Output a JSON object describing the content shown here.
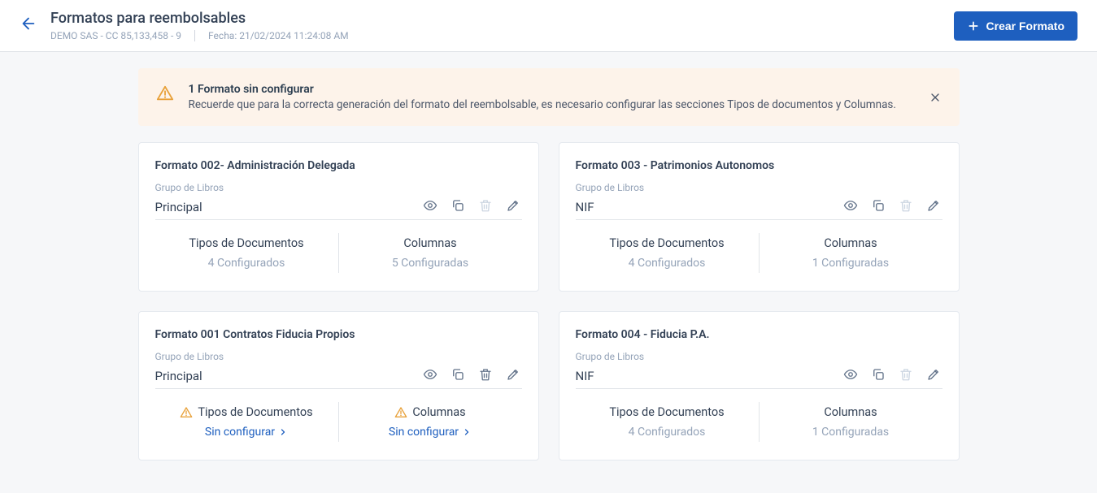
{
  "header": {
    "title": "Formatos para reembolsables",
    "company": "DEMO SAS - CC 85,133,458 - 9",
    "date_prefix": "Fecha: ",
    "date": "21/02/2024 11:24:08 AM",
    "create_button": "Crear Formato"
  },
  "alert": {
    "title": "1 Formato sin configurar",
    "message": "Recuerde que para la correcta generación del formato del reembolsable, es necesario configurar las secciones Tipos de documentos y Columnas."
  },
  "labels": {
    "grupo_libros": "Grupo de Libros",
    "tipos_documentos": "Tipos de Documentos",
    "columnas": "Columnas",
    "sin_configurar": "Sin configurar"
  },
  "cards": [
    {
      "title": "Formato 002- Administración Delegada",
      "group": "Principal",
      "delete_enabled": false,
      "tipos": {
        "configured": true,
        "text": "4 Configurados"
      },
      "columnas": {
        "configured": true,
        "text": "5 Configuradas"
      }
    },
    {
      "title": "Formato 003 - Patrimonios Autonomos",
      "group": "NIF",
      "delete_enabled": false,
      "tipos": {
        "configured": true,
        "text": "4 Configurados"
      },
      "columnas": {
        "configured": true,
        "text": "1 Configuradas"
      }
    },
    {
      "title": "Formato 001 Contratos Fiducia Propios",
      "group": "Principal",
      "delete_enabled": true,
      "tipos": {
        "configured": false
      },
      "columnas": {
        "configured": false
      }
    },
    {
      "title": "Formato 004 - Fiducia P.A.",
      "group": "NIF",
      "delete_enabled": false,
      "tipos": {
        "configured": true,
        "text": "4 Configurados"
      },
      "columnas": {
        "configured": true,
        "text": "1 Configuradas"
      }
    }
  ]
}
